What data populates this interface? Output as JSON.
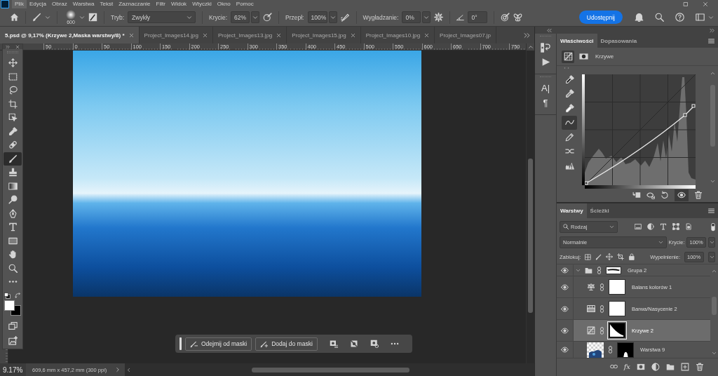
{
  "menu_bar": [
    {
      "label": "Plik",
      "selected": true
    },
    {
      "label": "Edycja",
      "selected": false
    },
    {
      "label": "Obraz",
      "selected": false
    },
    {
      "label": "Warstwa",
      "selected": false
    },
    {
      "label": "Tekst",
      "selected": false
    },
    {
      "label": "Zaznaczanie",
      "selected": false
    },
    {
      "label": "Filtr",
      "selected": false
    },
    {
      "label": "Widok",
      "selected": false
    },
    {
      "label": "Wtyczki",
      "selected": false
    },
    {
      "label": "Okno",
      "selected": false
    },
    {
      "label": "Pomoc",
      "selected": false
    }
  ],
  "options_bar": {
    "brush_size": "600",
    "mode": {
      "label": "Tryb:",
      "value": "Zwykły"
    },
    "opacity": {
      "label": "Krycie:",
      "value": "62%"
    },
    "flow": {
      "label": "Przepł:",
      "value": "100%"
    },
    "smoothing": {
      "label": "Wygładzanie:",
      "value": "0%"
    },
    "angle": {
      "value": "0°"
    },
    "share_button": "Udostępnij"
  },
  "document_tabs": [
    {
      "label": "5.psd @ 9,17% (Krzywe 2,Maska warstwy/8) *",
      "selected": true,
      "closable": true
    },
    {
      "label": "Project_Images14.jpg",
      "selected": false,
      "closable": true
    },
    {
      "label": "Project_Images13.jpg",
      "selected": false,
      "closable": true
    },
    {
      "label": "Project_Images15.jpg",
      "selected": false,
      "closable": true
    },
    {
      "label": "Project_Images10.jpg",
      "selected": false,
      "closable": true
    },
    {
      "label": "Project_Images07.jp",
      "selected": false,
      "closable": false
    }
  ],
  "ruler": {
    "labels": [
      "50",
      "0",
      "50",
      "100",
      "150",
      "200",
      "250",
      "300",
      "350",
      "400",
      "450",
      "500",
      "550",
      "600",
      "650",
      "700",
      "750"
    ]
  },
  "tools": [
    {
      "kind": "move",
      "selected": false
    },
    {
      "kind": "marquee",
      "selected": false
    },
    {
      "kind": "lasso",
      "selected": false
    },
    {
      "kind": "crop",
      "selected": false
    },
    {
      "kind": "object-select",
      "selected": false
    },
    {
      "kind": "eyedropper",
      "selected": false
    },
    {
      "kind": "healing",
      "selected": false
    },
    {
      "kind": "brush",
      "selected": true
    },
    {
      "kind": "stamp",
      "selected": false
    },
    {
      "kind": "gradient",
      "selected": false
    },
    {
      "kind": "dodge",
      "selected": false
    },
    {
      "kind": "pen",
      "selected": false
    },
    {
      "kind": "type",
      "selected": false
    },
    {
      "kind": "rectangle",
      "selected": false
    },
    {
      "kind": "hand",
      "selected": false
    },
    {
      "kind": "zoom",
      "selected": false
    },
    {
      "kind": "more",
      "selected": false
    }
  ],
  "color_swatches": [
    {
      "kind": "foreground",
      "color": "#ffffff"
    },
    {
      "kind": "background",
      "color": "#000000"
    }
  ],
  "mask_task_bar": {
    "buttons": [
      {
        "kind": "subtract",
        "label": "Odejmij od maski"
      },
      {
        "kind": "add",
        "label": "Dodaj do maski"
      }
    ]
  },
  "status_bar": {
    "zoom": "9.17%",
    "document_size": "609,6 mm x 457,2 mm (300 ppi)"
  },
  "side_dock": [
    {
      "kind": "history"
    },
    {
      "kind": "actions"
    },
    {
      "kind": "character",
      "glyph": "A|"
    },
    {
      "kind": "paragraph",
      "glyph": "¶"
    }
  ],
  "properties_panel": {
    "tabs": [
      {
        "label": "Właściwości",
        "selected": true
      },
      {
        "label": "Dopasowania",
        "selected": false
      }
    ],
    "header_buttons": [
      {
        "kind": "adjustment",
        "selected": true
      },
      {
        "kind": "mask",
        "selected": false
      }
    ],
    "title": "Krzywe",
    "curve_tools": [
      {
        "kind": "black-point",
        "selected": false
      },
      {
        "kind": "gray-point",
        "selected": false
      },
      {
        "kind": "white-point",
        "selected": false
      },
      {
        "kind": "points",
        "selected": true
      },
      {
        "kind": "pencil",
        "selected": false
      },
      {
        "kind": "smooth",
        "selected": false
      },
      {
        "kind": "clipping",
        "selected": false
      }
    ],
    "preview_on": true
  },
  "layers_panel": {
    "tabs": [
      {
        "label": "Warstwy",
        "selected": true
      },
      {
        "label": "Ścieżki",
        "selected": false
      }
    ],
    "filter": "Rodzaj",
    "blend_mode": "Normalnie",
    "opacity": {
      "label": "Krycie:",
      "value": "100%"
    },
    "lock_label": "Zablokuj:",
    "fill": {
      "label": "Wypełnienie:",
      "value": "100%"
    },
    "layers": [
      {
        "name": "Grupa 2",
        "kind": "group",
        "visible": true,
        "selected": false,
        "expanded": true,
        "mask": {
          "kind": "stroke"
        },
        "children": [
          {
            "name": "Balans kolorów 1",
            "kind": "color-balance",
            "visible": true,
            "selected": false,
            "mask": {
              "kind": "white"
            }
          },
          {
            "name": "Barwa/Nasycenie 2",
            "kind": "hue-saturation",
            "visible": true,
            "selected": false,
            "mask": {
              "kind": "white"
            }
          },
          {
            "name": "Krzywe 2",
            "kind": "curves",
            "visible": true,
            "selected": true,
            "mask": {
              "kind": "corner"
            }
          },
          {
            "name": "Warstwa 9",
            "kind": "pixel",
            "visible": true,
            "selected": false,
            "mask": {
              "kind": "figure"
            }
          }
        ]
      }
    ],
    "effects_button": "fx"
  }
}
